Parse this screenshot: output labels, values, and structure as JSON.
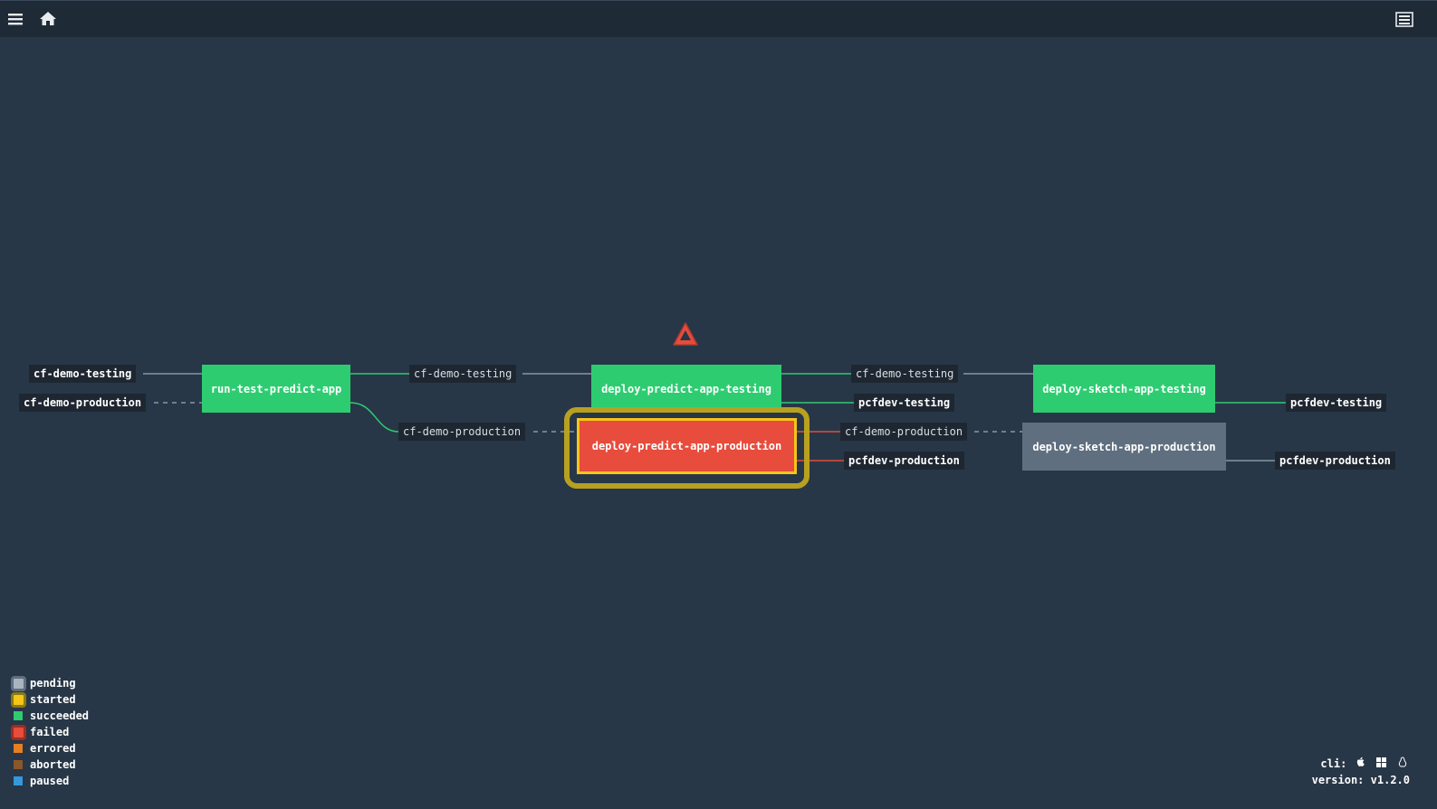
{
  "topbar": {
    "menu_icon": "hamburger-icon",
    "home_icon": "home-icon",
    "sidebar_icon": "sidebar-toggle-icon"
  },
  "colors": {
    "background": "#273747",
    "topbar": "#1e2a36",
    "succeeded": "#2ecc71",
    "failed": "#e74c3c",
    "pending": "#5f6f80",
    "started": "#f5c518",
    "errored": "#e67e22",
    "aborted": "#8b572a",
    "paused": "#3498db"
  },
  "pipeline": {
    "status_icon": "warning-triangle-icon",
    "jobs": {
      "run_test_predict_app": {
        "name": "run-test-predict-app",
        "status": "succeeded"
      },
      "deploy_predict_app_testing": {
        "name": "deploy-predict-app-testing",
        "status": "succeeded"
      },
      "deploy_predict_app_production": {
        "name": "deploy-predict-app-production",
        "status": "failed",
        "running": true
      },
      "deploy_sketch_app_testing": {
        "name": "deploy-sketch-app-testing",
        "status": "succeeded"
      },
      "deploy_sketch_app_production": {
        "name": "deploy-sketch-app-production",
        "status": "pending"
      }
    },
    "resources": {
      "in_cf_demo_testing": "cf-demo-testing",
      "in_cf_demo_production": "cf-demo-production",
      "mid_cf_demo_testing": "cf-demo-testing",
      "mid_cf_demo_production": "cf-demo-production",
      "out_cf_demo_testing": "cf-demo-testing",
      "out_pcfdev_testing": "pcfdev-testing",
      "out_cf_demo_production": "cf-demo-production",
      "out_pcfdev_production": "pcfdev-production",
      "end_pcfdev_testing": "pcfdev-testing",
      "end_pcfdev_production": "pcfdev-production"
    }
  },
  "legend": [
    {
      "label": "pending",
      "color": "#5f6f80",
      "ring": true
    },
    {
      "label": "started",
      "color": "#f5c518",
      "ring": true
    },
    {
      "label": "succeeded",
      "color": "#2ecc71",
      "ring": false
    },
    {
      "label": "failed",
      "color": "#e74c3c",
      "ring": true
    },
    {
      "label": "errored",
      "color": "#e67e22",
      "ring": false
    },
    {
      "label": "aborted",
      "color": "#8b572a",
      "ring": false
    },
    {
      "label": "paused",
      "color": "#3498db",
      "ring": false
    }
  ],
  "footer": {
    "cli_label": "cli:",
    "cli_icons": [
      "apple-icon",
      "windows-icon",
      "linux-icon"
    ],
    "version_label": "version:",
    "version_value": "v1.2.0"
  }
}
